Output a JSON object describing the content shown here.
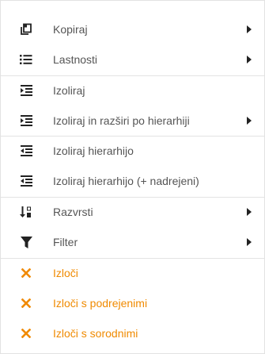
{
  "menu": {
    "items": [
      {
        "label": "Kopiraj",
        "icon": "copy-icon"
      },
      {
        "label": "Lastnosti",
        "icon": "list-icon"
      },
      {
        "label": "Izoliraj",
        "icon": "indent-icon"
      },
      {
        "label": "Izoliraj in razširi po hierarhiji",
        "icon": "indent-icon"
      },
      {
        "label": "Izoliraj hierarhijo",
        "icon": "outdent-icon"
      },
      {
        "label": "Izoliraj hierarhijo (+ nadrejeni)",
        "icon": "outdent-icon"
      },
      {
        "label": "Razvrsti",
        "icon": "sort-icon"
      },
      {
        "label": "Filter",
        "icon": "filter-icon"
      },
      {
        "label": "Izloči",
        "icon": "close-icon"
      },
      {
        "label": "Izloči s podrejenimi",
        "icon": "close-icon"
      },
      {
        "label": "Izloči s sorodnimi",
        "icon": "close-icon"
      }
    ],
    "colors": {
      "text": "#555555",
      "icon": "#222222",
      "accent": "#f08a00",
      "divider": "#e3e3e3"
    }
  }
}
